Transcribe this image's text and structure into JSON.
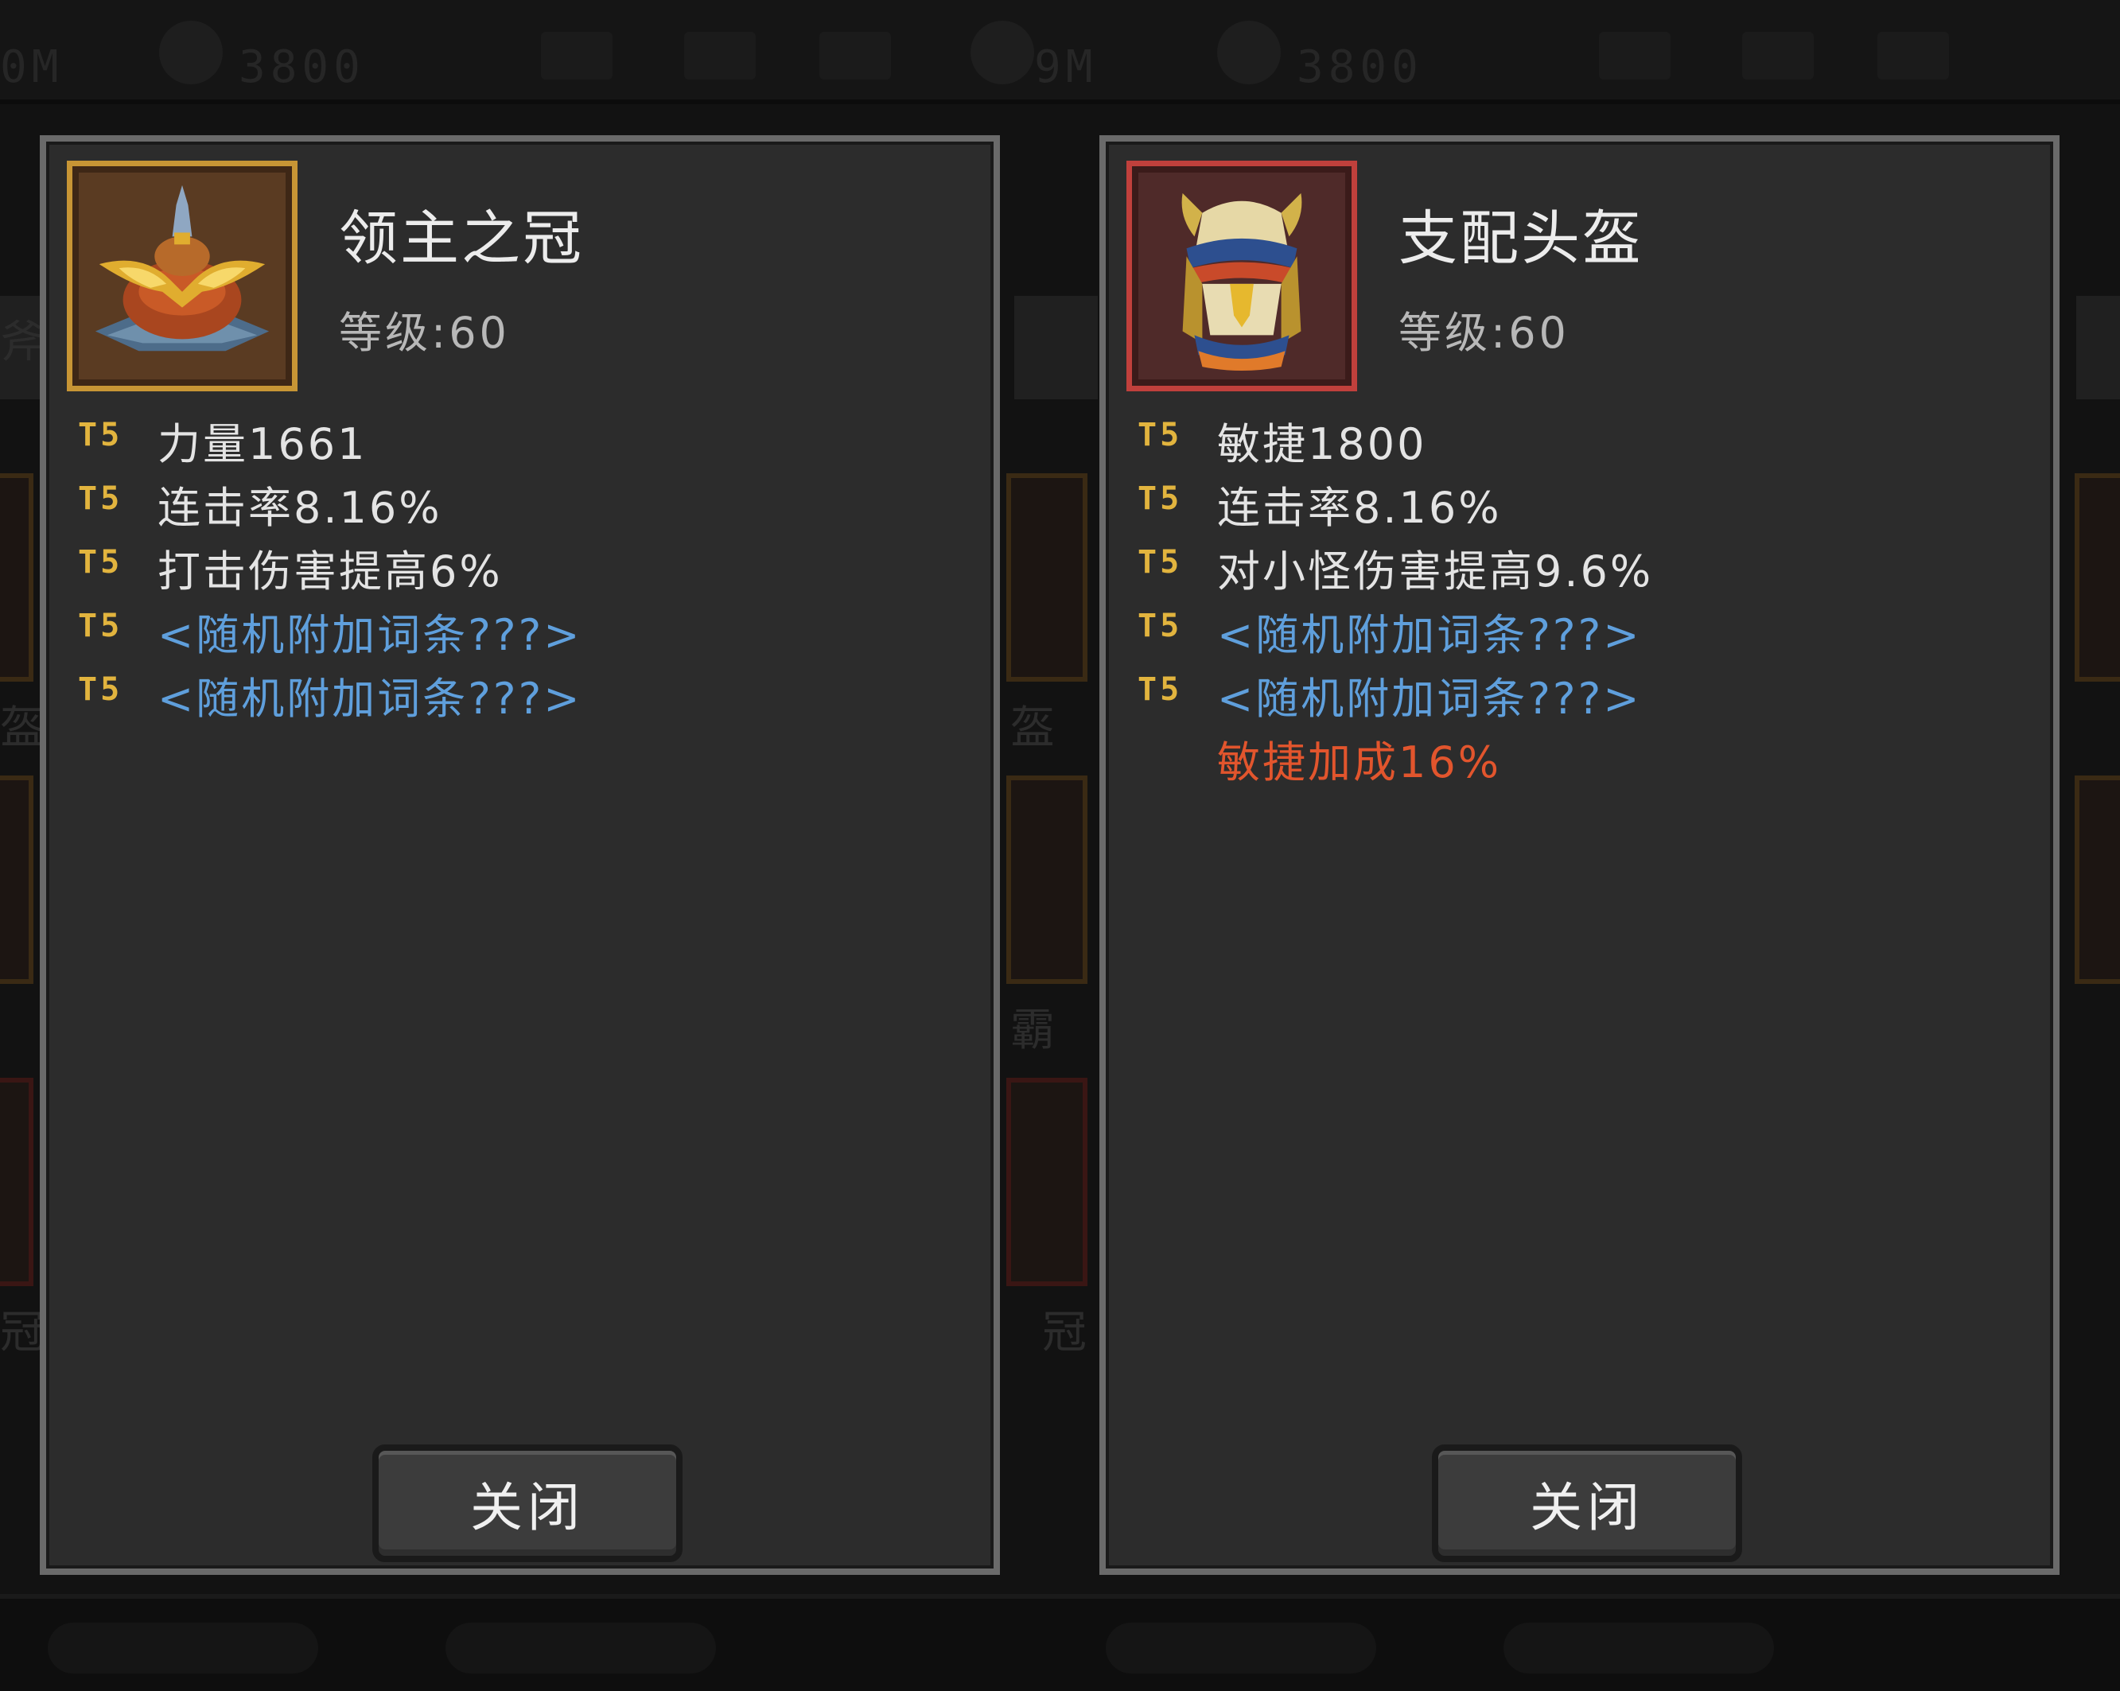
{
  "background": {
    "top_tokens": [
      "3800",
      "3800",
      "9M",
      "0M"
    ],
    "side_chars": [
      "斧",
      "盔",
      "冠",
      "霸",
      "盔",
      "冠"
    ]
  },
  "items": [
    {
      "name": "领主之冠",
      "level": "等级:60",
      "frame_color": "#c79535",
      "icon": "crown-icon",
      "stats": [
        {
          "tier": "T5",
          "text": "力量1661",
          "type": "normal"
        },
        {
          "tier": "T5",
          "text": "连击率8.16%",
          "type": "normal"
        },
        {
          "tier": "T5",
          "text": "打击伤害提高6%",
          "type": "normal"
        },
        {
          "tier": "T5",
          "text": "<随机附加词条???>",
          "type": "random"
        },
        {
          "tier": "T5",
          "text": "<随机附加词条???>",
          "type": "random"
        }
      ],
      "close_label": "关闭"
    },
    {
      "name": "支配头盔",
      "level": "等级:60",
      "frame_color": "#c0403c",
      "icon": "helmet-icon",
      "stats": [
        {
          "tier": "T5",
          "text": "敏捷1800",
          "type": "normal"
        },
        {
          "tier": "T5",
          "text": "连击率8.16%",
          "type": "normal"
        },
        {
          "tier": "T5",
          "text": "对小怪伤害提高9.6%",
          "type": "normal"
        },
        {
          "tier": "T5",
          "text": "<随机附加词条???>",
          "type": "random"
        },
        {
          "tier": "T5",
          "text": "<随机附加词条???>",
          "type": "random"
        },
        {
          "tier": "",
          "text": "敏捷加成16%",
          "type": "bonus"
        }
      ],
      "close_label": "关闭"
    }
  ],
  "colors": {
    "tier": "#e2b43e",
    "random_affix": "#5f9fdc",
    "set_bonus": "#e2552d",
    "panel_bg": "#2c2c2c",
    "panel_border": "#6a6a6a"
  }
}
